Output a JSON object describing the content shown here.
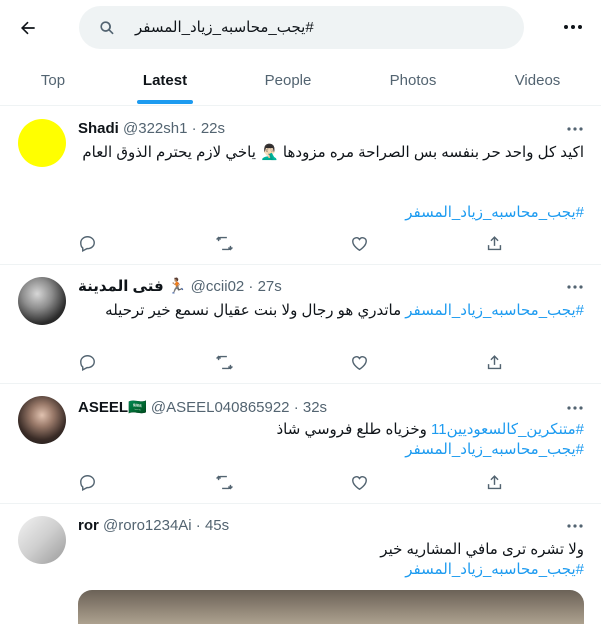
{
  "search": {
    "query": "#يجب_محاسبه_زياد_المسفر"
  },
  "tabs": [
    {
      "label": "Top"
    },
    {
      "label": "Latest"
    },
    {
      "label": "People"
    },
    {
      "label": "Photos"
    },
    {
      "label": "Videos"
    }
  ],
  "tweets": [
    {
      "name": "Shadi",
      "handle": "@322sh1",
      "time": "22s",
      "text": "اكيد كل واحد حر بنفسه بس الصراحة مره مزودها 🤦🏻‍♂️ ياخي لازم يحترم الذوق العام",
      "hashtag": "#يجب_محاسبه_زياد_المسفر",
      "avatar_color": "#ffff00"
    },
    {
      "name": "فتى المدينة 🏃🏽",
      "handle": "@ccii02",
      "time": "27s",
      "hashtag": "#يجب_محاسبه_زياد_المسفر",
      "text": " ماتدري هو رجال ولا بنت عقيال نسمع خير ترحيله"
    },
    {
      "name": "ASEEL🇸🇦",
      "handle": "@ASEEL040865922",
      "time": "32s",
      "hashtag_a": "#متنكرين_كالسعوديين11",
      "text": " وخزياه طلع فروسي شاذ",
      "hashtag": "#يجب_محاسبه_زياد_المسفر"
    },
    {
      "name": "ror",
      "handle": "@roro1234Ai",
      "time": "45s",
      "text": "ولا تشره ترى مافي المشاريه خير",
      "hashtag": "#يجب_محاسبه_زياد_المسفر"
    }
  ],
  "colors": {
    "accent": "#1d9bf0",
    "muted": "#536471",
    "text": "#0f1419"
  },
  "icons": [
    "back-arrow-icon",
    "search-icon",
    "more-icon",
    "reply-icon",
    "retweet-icon",
    "like-icon",
    "share-icon"
  ]
}
